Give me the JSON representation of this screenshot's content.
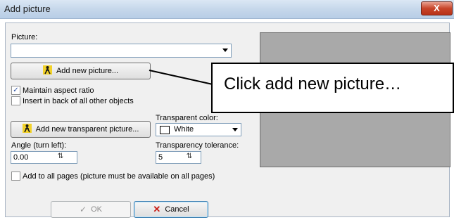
{
  "window": {
    "title": "Add picture",
    "close_glyph": "X"
  },
  "picture": {
    "label": "Picture:",
    "value": ""
  },
  "buttons": {
    "add_new_picture": "Add new picture...",
    "add_transparent": "Add new transparent picture...",
    "ok": "OK",
    "cancel": "Cancel"
  },
  "checkboxes": {
    "maintain_aspect": {
      "label": "Maintain aspect ratio",
      "checked": true,
      "mark": "✓"
    },
    "insert_back": {
      "label": "Insert in back of all other objects",
      "checked": false,
      "mark": ""
    },
    "add_all_pages": {
      "label": "Add to all pages (picture must be available on all pages)",
      "checked": false,
      "mark": ""
    }
  },
  "transparent_color": {
    "label": "Transparent color:",
    "value": "White"
  },
  "angle": {
    "label": "Angle (turn left):",
    "value": "0.00"
  },
  "tolerance": {
    "label": "Transparency tolerance:",
    "value": "5"
  },
  "callout": {
    "text": "Click add new picture…"
  },
  "icons": {
    "picture": "picture-icon",
    "ok": "checkmark-icon",
    "cancel": "cancel-x-icon",
    "spin": "spin-arrows-icon"
  },
  "colors": {
    "preview_bg": "#a9a9a9",
    "cancel_icon": "#c8201a",
    "swatch": "#ffffff"
  }
}
